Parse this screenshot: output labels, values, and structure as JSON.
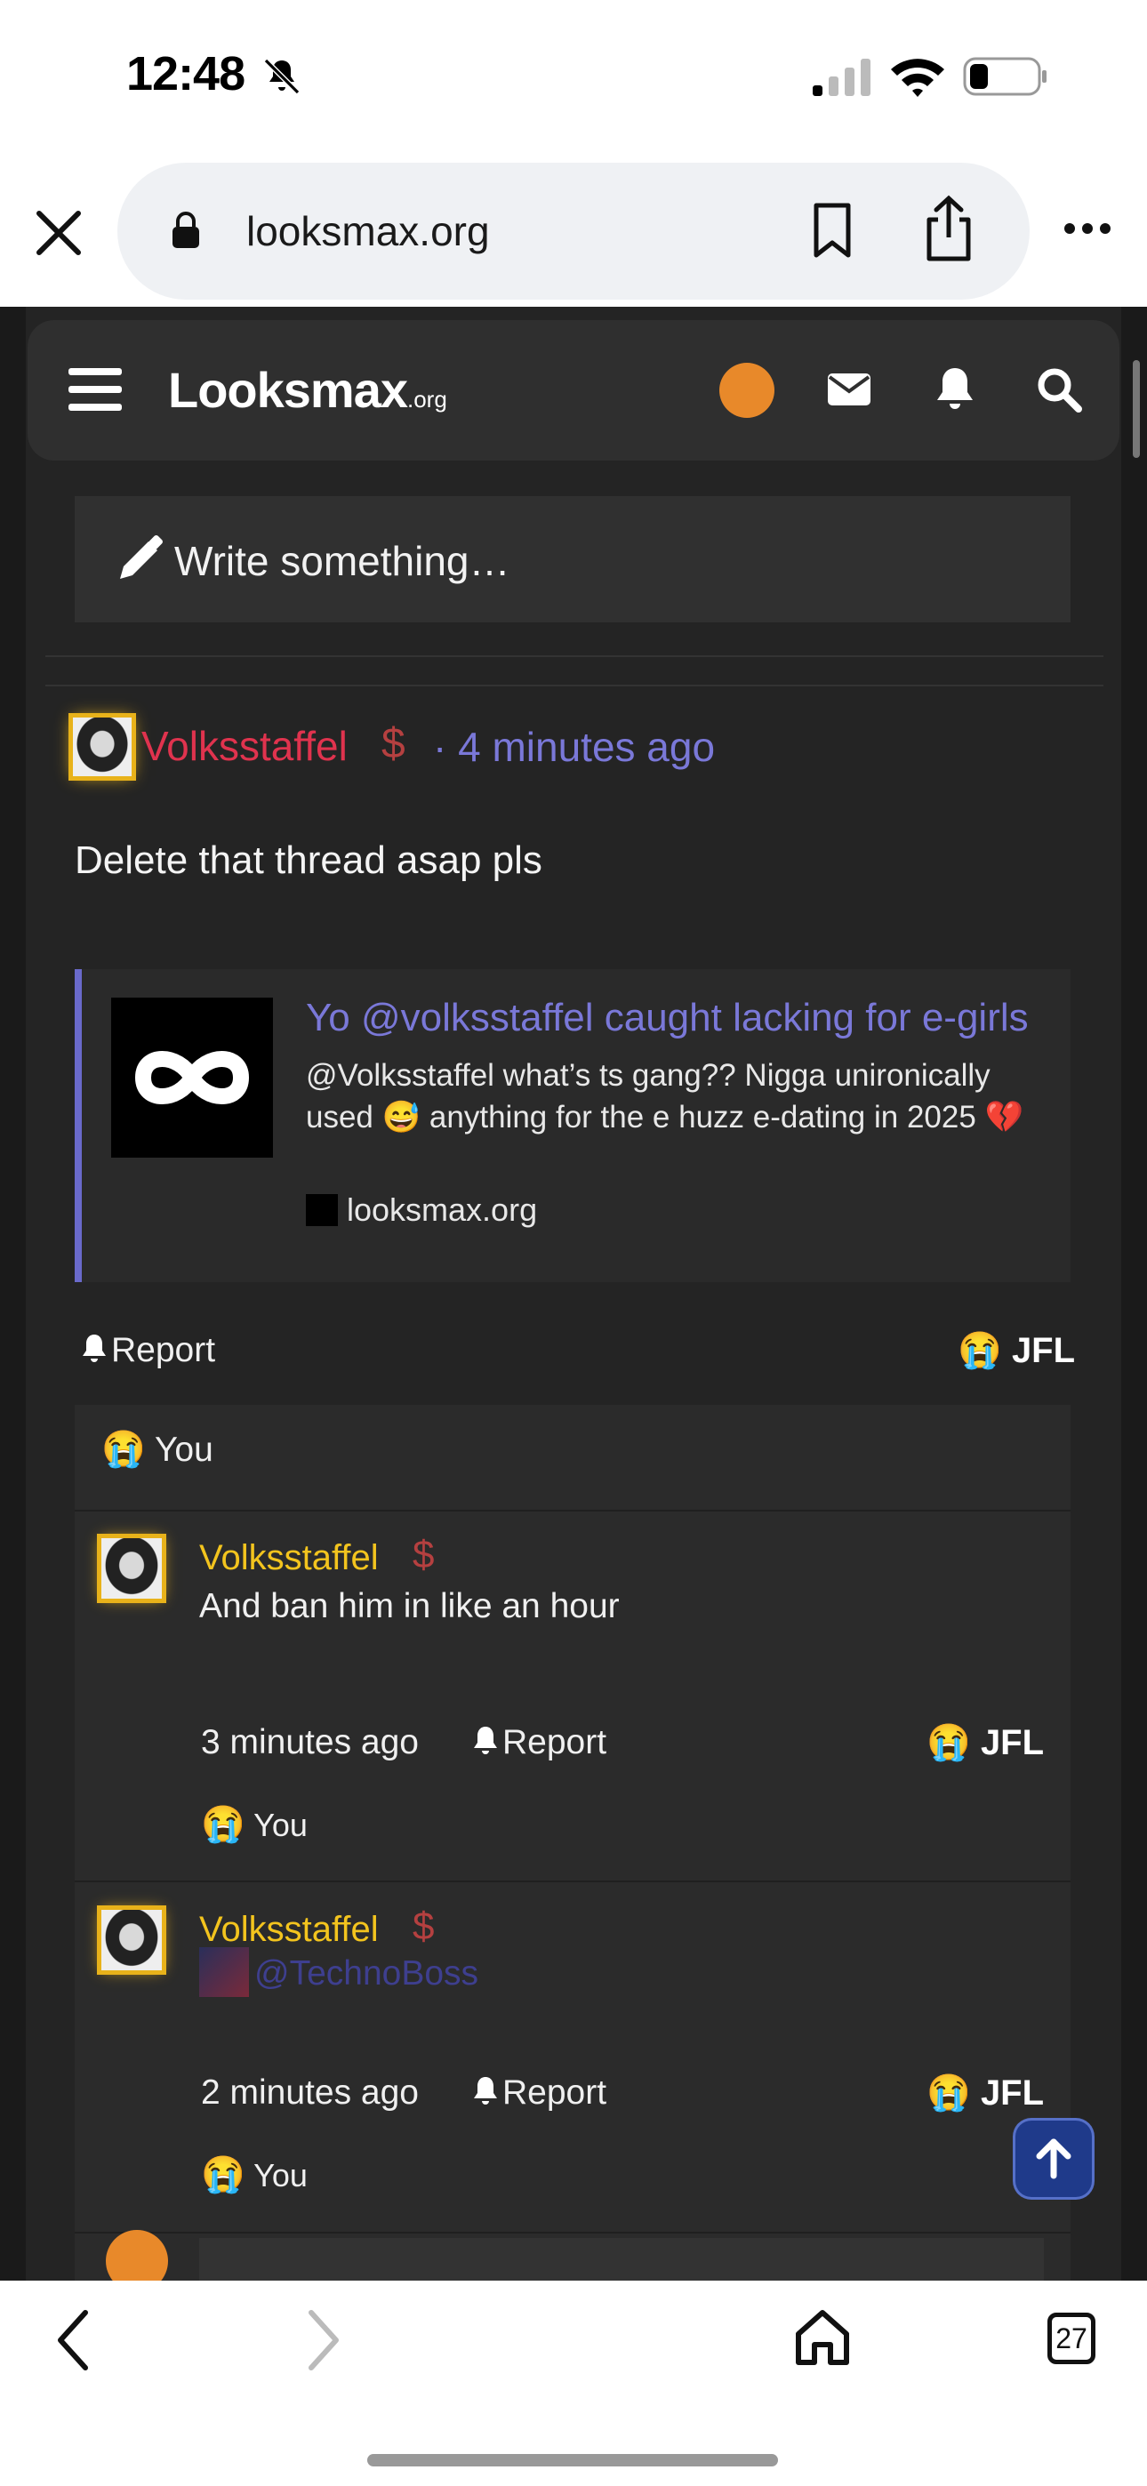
{
  "status_bar": {
    "time": "12:48"
  },
  "url_bar": {
    "domain": "looksmax.org"
  },
  "site_nav": {
    "logo": "Looksmax",
    "logo_suffix": ".org"
  },
  "composer": {
    "placeholder": "Write something…"
  },
  "post": {
    "username": "Volksstaffel",
    "badge": "$",
    "time": "· 4 minutes ago",
    "body": "Delete that thread asap pls",
    "embed": {
      "title": "Yo @volksstaffel caught lacking for e-girls",
      "description": "@Volksstaffel what’s ts gang?? Nigga unironically used 😅 anything for the e huzz e-dating in 2025 💔",
      "site": "looksmax.org"
    },
    "report_label": "Report",
    "reaction_emoji": "😭",
    "reaction_label": "JFL",
    "reacted_by": "You"
  },
  "replies": [
    {
      "username": "Volksstaffel",
      "badge": "$",
      "text": "And ban him in like an hour",
      "time": "3 minutes ago",
      "report_label": "Report",
      "reaction_emoji": "😭",
      "reaction_label": "JFL",
      "reacted_by": "You"
    },
    {
      "username": "Volksstaffel",
      "badge": "$",
      "mention": "@TechnoBoss",
      "time": "2 minutes ago",
      "report_label": "Report",
      "reaction_emoji": "😭",
      "reaction_label": "JFL",
      "reacted_by": "You"
    }
  ],
  "toolbar": {
    "tab_count": "27"
  },
  "colors": {
    "accent": "#7a78d8",
    "username_post": "#e0334e",
    "username_reply": "#f3c41e",
    "avatar_glow": "#e8b21a"
  }
}
